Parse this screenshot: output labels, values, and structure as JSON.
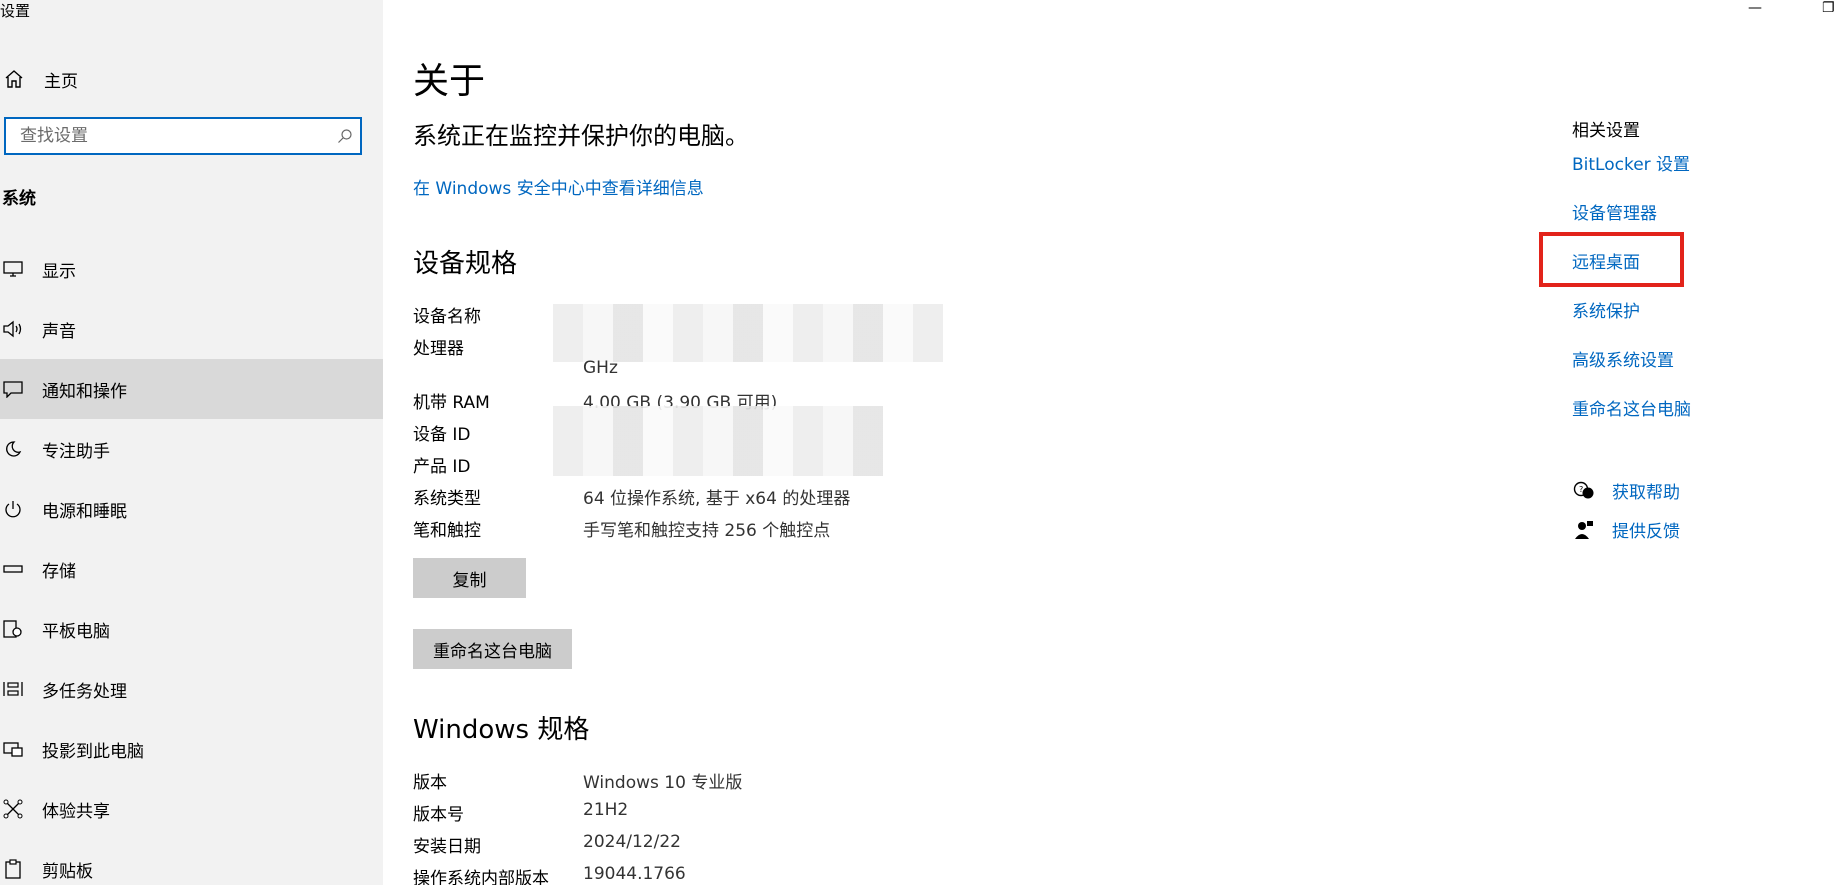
{
  "window": {
    "title": "设置",
    "minimize_glyph": "—",
    "restore_glyph": "❐"
  },
  "sidebar": {
    "home_label": "主页",
    "search_placeholder": "查找设置",
    "section_title": "系统",
    "items": [
      {
        "label": "显示",
        "icon": "monitor-icon"
      },
      {
        "label": "声音",
        "icon": "speaker-icon"
      },
      {
        "label": "通知和操作",
        "icon": "notification-icon",
        "selected": true
      },
      {
        "label": "专注助手",
        "icon": "moon-icon"
      },
      {
        "label": "电源和睡眠",
        "icon": "power-icon"
      },
      {
        "label": "存储",
        "icon": "storage-icon"
      },
      {
        "label": "平板电脑",
        "icon": "tablet-icon"
      },
      {
        "label": "多任务处理",
        "icon": "multitask-icon"
      },
      {
        "label": "投影到此电脑",
        "icon": "projector-icon"
      },
      {
        "label": "体验共享",
        "icon": "share-icon"
      },
      {
        "label": "剪贴板",
        "icon": "clipboard-icon"
      }
    ]
  },
  "main": {
    "title": "关于",
    "status": "系统正在监控并保护你的电脑。",
    "security_link": "在 Windows 安全中心中查看详细信息",
    "device_specs_heading": "设备规格",
    "device_specs": [
      {
        "key": "设备名称",
        "value": ""
      },
      {
        "key": "处理器",
        "value": "GHz"
      },
      {
        "key": "机带 RAM",
        "value": "4.00 GB (3.90 GB 可用)"
      },
      {
        "key": "设备 ID",
        "value": ""
      },
      {
        "key": "产品 ID",
        "value": ""
      },
      {
        "key": "系统类型",
        "value": "64 位操作系统, 基于 x64 的处理器"
      },
      {
        "key": "笔和触控",
        "value": "手写笔和触控支持 256 个触控点"
      }
    ],
    "copy_button": "复制",
    "rename_button": "重命名这台电脑",
    "windows_specs_heading": "Windows 规格",
    "windows_specs": [
      {
        "key": "版本",
        "value": "Windows 10 专业版"
      },
      {
        "key": "版本号",
        "value": "21H2"
      },
      {
        "key": "安装日期",
        "value": "2024/12/22"
      },
      {
        "key": "操作系统内部版本",
        "value": "19044.1766"
      }
    ]
  },
  "related": {
    "title": "相关设置",
    "links": [
      "BitLocker 设置",
      "设备管理器",
      "远程桌面",
      "系统保护",
      "高级系统设置",
      "重命名这台电脑"
    ],
    "help": "获取帮助",
    "feedback": "提供反馈"
  },
  "colors": {
    "accent": "#0067c0",
    "highlight": "#e2231a",
    "sidebar_bg": "#f2f2f2",
    "selected_bg": "#d9d9d9"
  }
}
